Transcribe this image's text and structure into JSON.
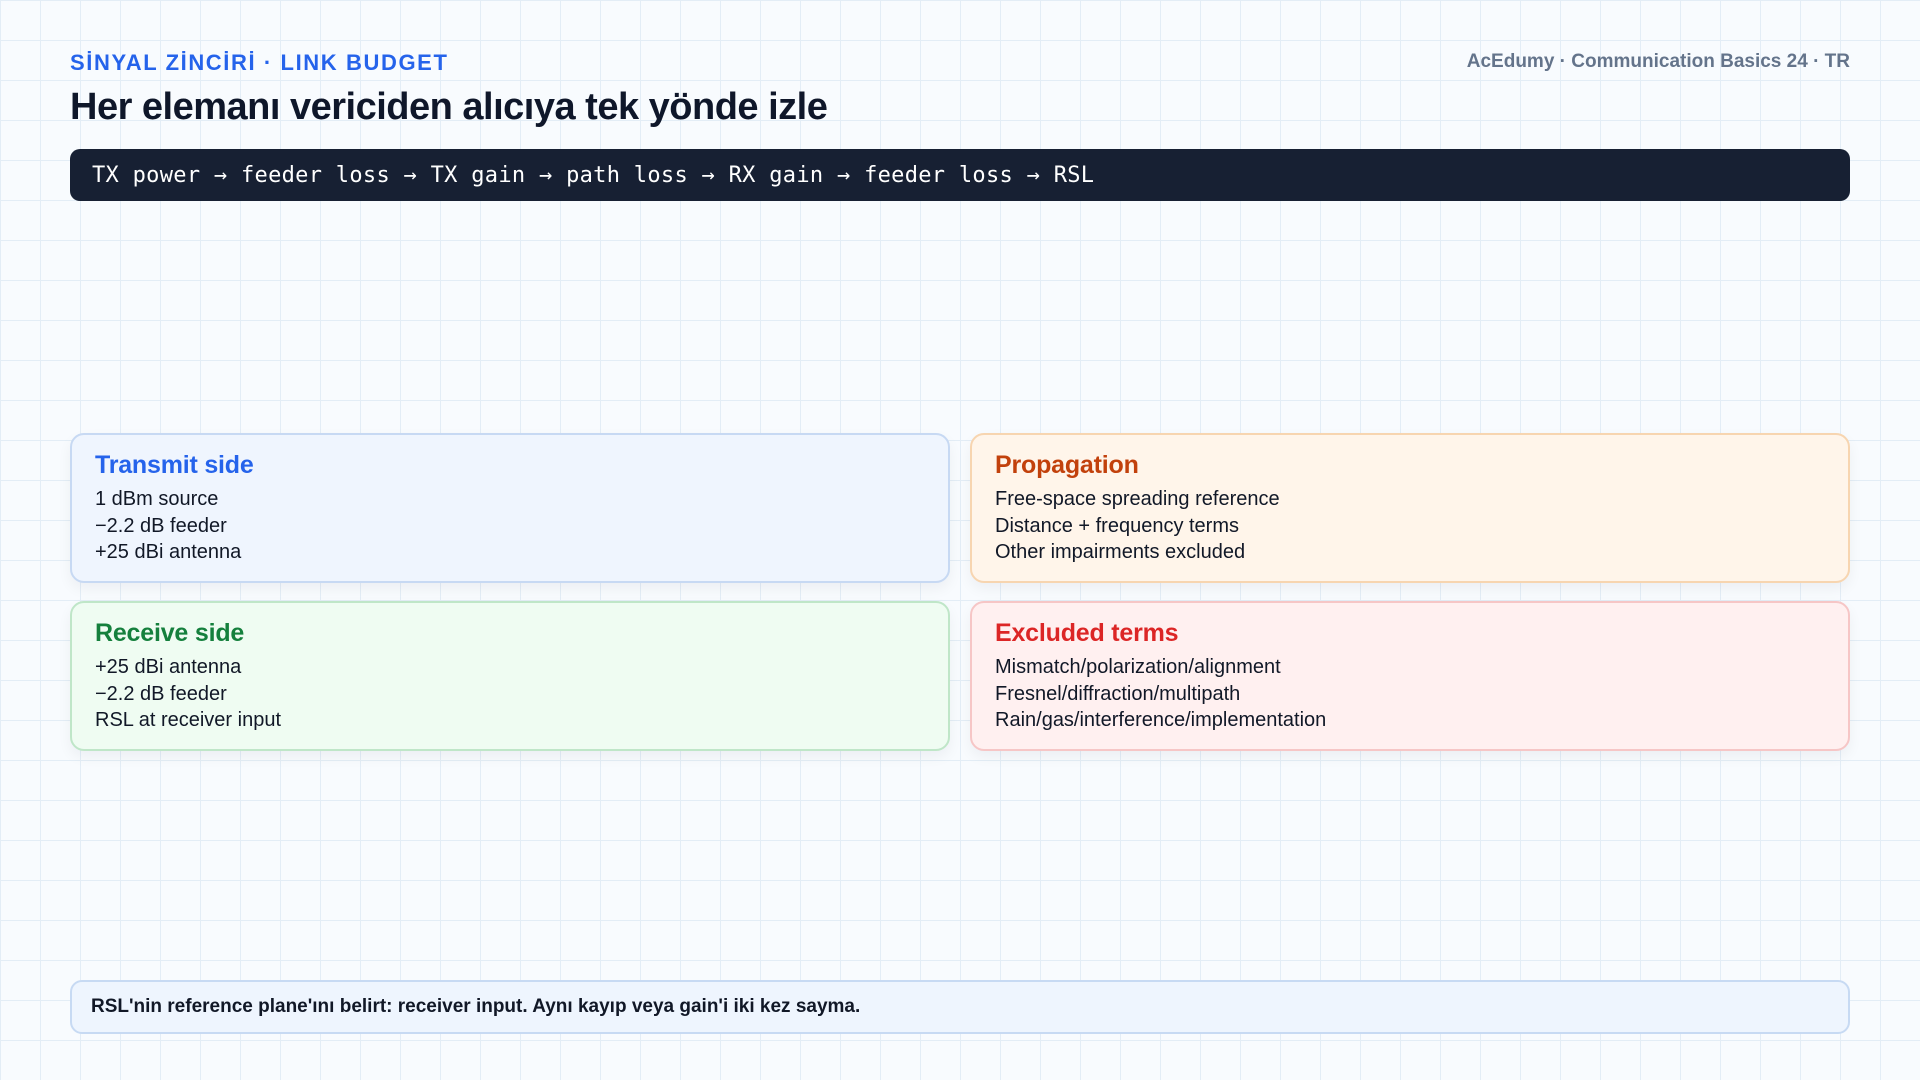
{
  "header": {
    "kicker": "SİNYAL ZİNCİRİ · LINK BUDGET",
    "brand": "AcEdumy · Communication Basics 24 · TR",
    "title": "Her elemanı vericiden alıcıya tek yönde izle"
  },
  "chain": {
    "text": "TX power → feeder loss → TX gain → path loss → RX gain → feeder loss → RSL"
  },
  "cards": [
    {
      "title": "Transmit side",
      "lines": [
        "1 dBm source",
        "−2.2 dB feeder",
        "+25 dBi antenna"
      ],
      "accent": "#2563eb"
    },
    {
      "title": "Propagation",
      "lines": [
        "Free-space spreading reference",
        "Distance + frequency terms",
        "Other impairments excluded"
      ],
      "accent": "#c2410c"
    },
    {
      "title": "Receive side",
      "lines": [
        "+25 dBi antenna",
        "−2.2 dB feeder",
        "RSL at receiver input"
      ],
      "accent": "#15803d"
    },
    {
      "title": "Excluded terms",
      "lines": [
        "Mismatch/polarization/alignment",
        "Fresnel/diffraction/multipath",
        "Rain/gas/interference/implementation"
      ],
      "accent": "#dc2626"
    }
  ],
  "note": {
    "text": "RSL'nin reference plane'ını belirt: receiver input. Aynı kayıp veya gain'i iki kez sayma."
  }
}
